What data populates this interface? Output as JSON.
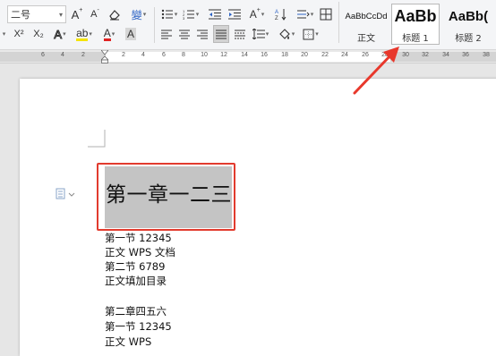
{
  "toolbar": {
    "font_size_value": "二号",
    "grow_font": "A",
    "shrink_font": "A",
    "clear_format": "◇",
    "phonetic": "變",
    "superscript": "X²",
    "subscript": "X₂",
    "text_effect": "A",
    "highlight": "ab",
    "font_color": "A",
    "char_shade": "A",
    "sort": "A",
    "paragraph_marks": "¶"
  },
  "styles": [
    {
      "sample": "AaBbCcDd",
      "name": "正文"
    },
    {
      "sample": "AaBb",
      "name": "标题 1"
    },
    {
      "sample": "AaBb(",
      "name": "标题 2"
    }
  ],
  "ruler": {
    "ticks": [
      "6",
      "4",
      "2",
      "2",
      "4",
      "6",
      "8",
      "10",
      "12",
      "14",
      "16",
      "18",
      "20",
      "22",
      "24",
      "26",
      "28",
      "30",
      "32",
      "34",
      "36",
      "38"
    ]
  },
  "document": {
    "heading": "第一章一二三",
    "lines": [
      "第一节 12345",
      "正文 WPS 文档",
      "第二节 6789",
      "正文填加目录",
      "",
      "第二章四五六",
      "第一节 12345",
      "正文 WPS"
    ]
  },
  "colors": {
    "highlight_box": "#e23b2e",
    "selection": "#c4c4c4",
    "annotation_arrow": "#e8382c"
  }
}
